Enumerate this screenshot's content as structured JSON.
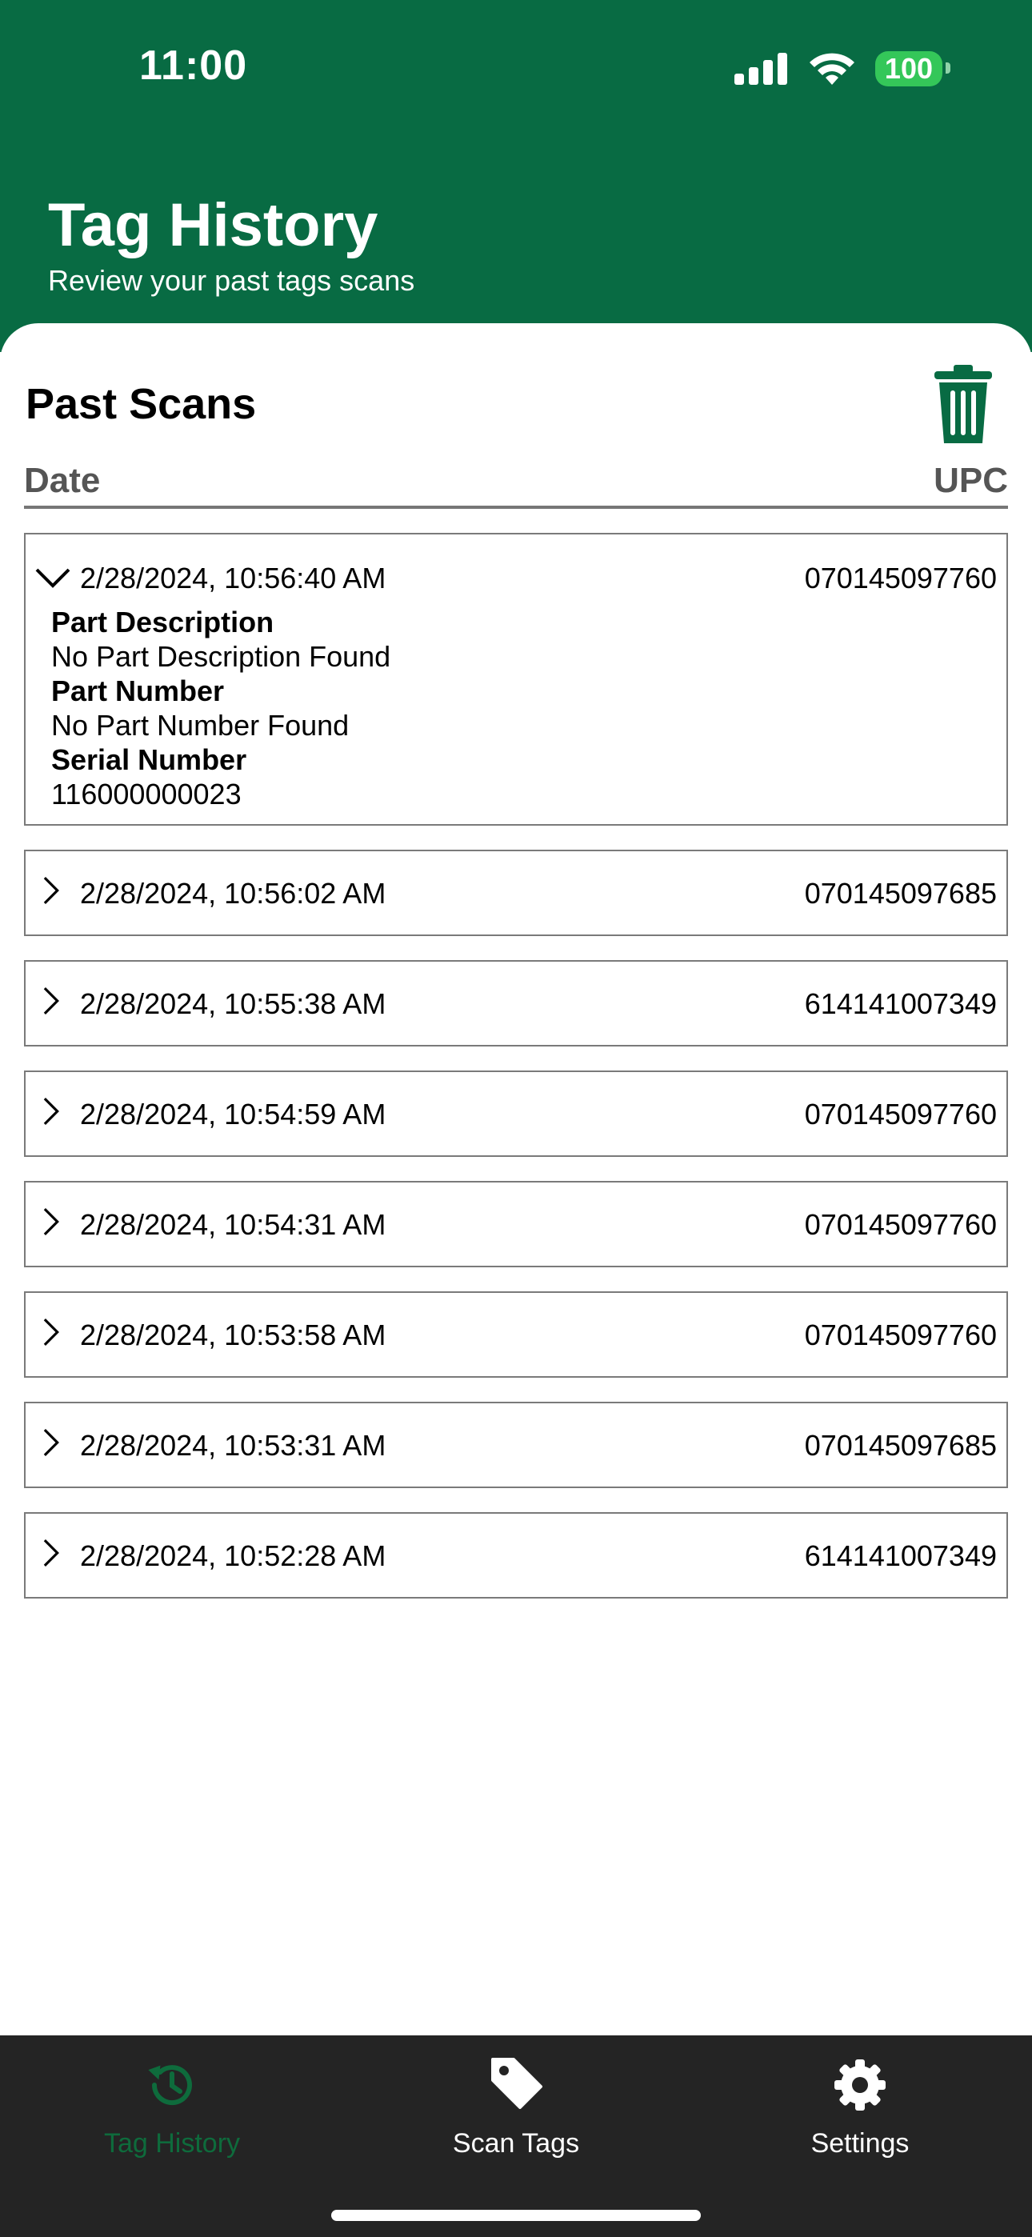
{
  "status": {
    "time": "11:00",
    "battery": "100"
  },
  "header": {
    "title": "Tag History",
    "subtitle": "Review your past tags scans"
  },
  "main": {
    "section_title": "Past Scans",
    "col_date": "Date",
    "col_upc": "UPC",
    "expanded": {
      "date": "2/28/2024, 10:56:40 AM",
      "upc": "070145097760",
      "part_description_label": "Part Description",
      "part_description": "No Part Description Found",
      "part_number_label": "Part Number",
      "part_number": "No Part Number Found",
      "serial_number_label": "Serial Number",
      "serial_number": "116000000023"
    },
    "rows": [
      {
        "date": "2/28/2024, 10:56:02 AM",
        "upc": "070145097685"
      },
      {
        "date": "2/28/2024, 10:55:38 AM",
        "upc": "614141007349"
      },
      {
        "date": "2/28/2024, 10:54:59 AM",
        "upc": "070145097760"
      },
      {
        "date": "2/28/2024, 10:54:31 AM",
        "upc": "070145097760"
      },
      {
        "date": "2/28/2024, 10:53:58 AM",
        "upc": "070145097760"
      },
      {
        "date": "2/28/2024, 10:53:31 AM",
        "upc": "070145097685"
      },
      {
        "date": "2/28/2024, 10:52:28 AM",
        "upc": "614141007349"
      }
    ]
  },
  "tabs": [
    {
      "label": "Tag History",
      "icon": "history-icon",
      "active": true
    },
    {
      "label": "Scan Tags",
      "icon": "tag-icon",
      "active": false
    },
    {
      "label": "Settings",
      "icon": "gear-icon",
      "active": false
    }
  ],
  "colors": {
    "brand": "#086b43",
    "tab_active": "#0e6b3c",
    "tabbar": "#242424"
  }
}
